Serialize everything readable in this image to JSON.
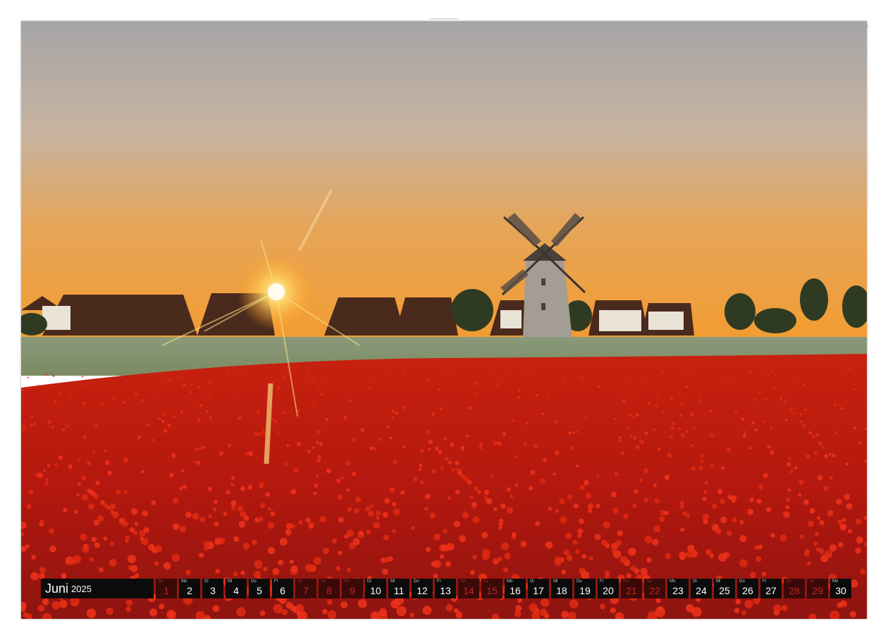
{
  "calendar": {
    "month": "Juni",
    "year": "2025",
    "days": [
      {
        "wd": "So",
        "n": "1",
        "weekend": true
      },
      {
        "wd": "Mo",
        "n": "2",
        "weekend": false
      },
      {
        "wd": "Di",
        "n": "3",
        "weekend": false
      },
      {
        "wd": "Mi",
        "n": "4",
        "weekend": false
      },
      {
        "wd": "Do",
        "n": "5",
        "weekend": false
      },
      {
        "wd": "Fr",
        "n": "6",
        "weekend": false
      },
      {
        "wd": "Sa",
        "n": "7",
        "weekend": true
      },
      {
        "wd": "So",
        "n": "8",
        "weekend": true
      },
      {
        "wd": "Mo",
        "n": "9",
        "weekend": true
      },
      {
        "wd": "Di",
        "n": "10",
        "weekend": false
      },
      {
        "wd": "Mi",
        "n": "11",
        "weekend": false
      },
      {
        "wd": "Do",
        "n": "12",
        "weekend": false
      },
      {
        "wd": "Fr",
        "n": "13",
        "weekend": false
      },
      {
        "wd": "Sa",
        "n": "14",
        "weekend": true
      },
      {
        "wd": "So",
        "n": "15",
        "weekend": true
      },
      {
        "wd": "Mo",
        "n": "16",
        "weekend": false
      },
      {
        "wd": "Di",
        "n": "17",
        "weekend": false
      },
      {
        "wd": "Mi",
        "n": "18",
        "weekend": false
      },
      {
        "wd": "Do",
        "n": "19",
        "weekend": false
      },
      {
        "wd": "Fr",
        "n": "20",
        "weekend": false
      },
      {
        "wd": "Sa",
        "n": "21",
        "weekend": true
      },
      {
        "wd": "So",
        "n": "22",
        "weekend": true
      },
      {
        "wd": "Mo",
        "n": "23",
        "weekend": false
      },
      {
        "wd": "Di",
        "n": "24",
        "weekend": false
      },
      {
        "wd": "Mi",
        "n": "25",
        "weekend": false
      },
      {
        "wd": "Do",
        "n": "26",
        "weekend": false
      },
      {
        "wd": "Fr",
        "n": "27",
        "weekend": false
      },
      {
        "wd": "Sa",
        "n": "28",
        "weekend": true
      },
      {
        "wd": "So",
        "n": "29",
        "weekend": true
      },
      {
        "wd": "Mo",
        "n": "30",
        "weekend": false
      }
    ]
  },
  "colors": {
    "sky_top": "#a7a6a7",
    "sky_horizon": "#f2a43c",
    "poppy": "#d2190f",
    "weekend_text": "#c4261f"
  }
}
